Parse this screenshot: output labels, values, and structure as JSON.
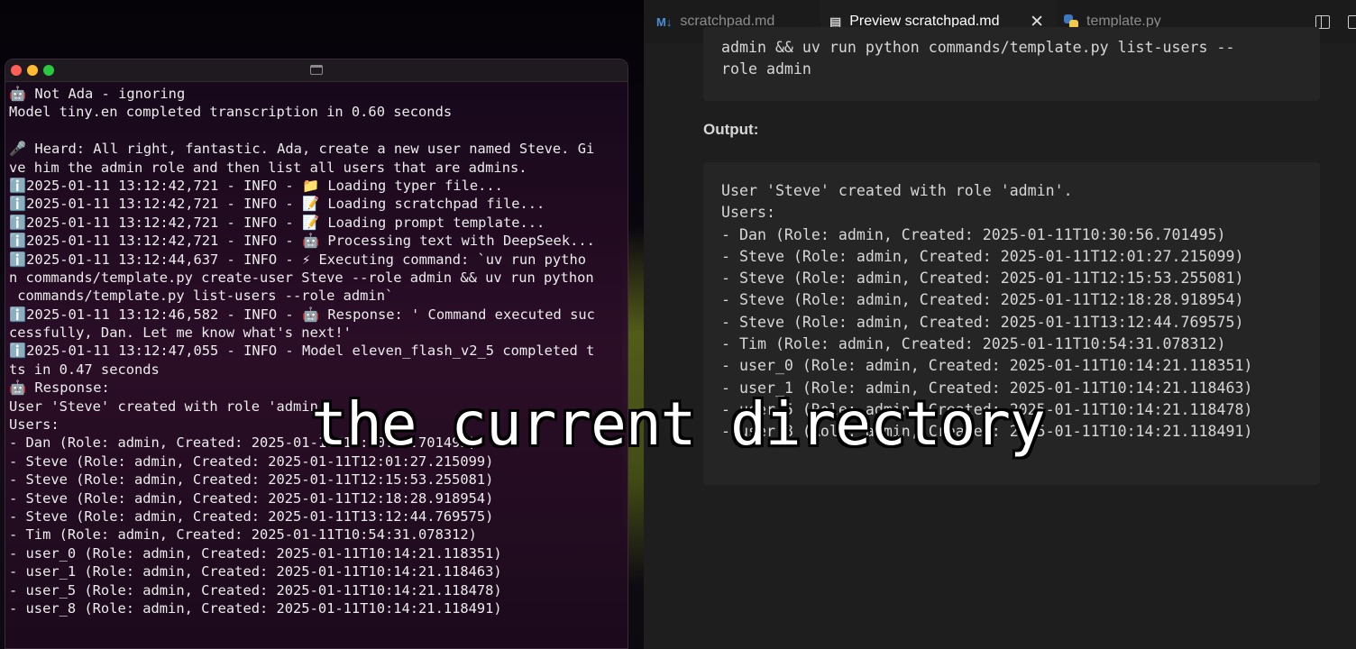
{
  "terminal": {
    "lines": [
      "🤖 Not Ada - ignoring",
      "Model tiny.en completed transcription in 0.60 seconds",
      "",
      "🎤 Heard: All right, fantastic. Ada, create a new user named Steve. Gi",
      "ve him the admin role and then list all users that are admins.",
      "ℹ️2025-01-11 13:12:42,721 - INFO - 📁 Loading typer file...",
      "ℹ️2025-01-11 13:12:42,721 - INFO - 📝 Loading scratchpad file...",
      "ℹ️2025-01-11 13:12:42,721 - INFO - 📝 Loading prompt template...",
      "ℹ️2025-01-11 13:12:42,721 - INFO - 🤖 Processing text with DeepSeek...",
      "ℹ️2025-01-11 13:12:44,637 - INFO - ⚡ Executing command: `uv run pytho",
      "n commands/template.py create-user Steve --role admin && uv run python",
      " commands/template.py list-users --role admin`",
      "ℹ️2025-01-11 13:12:46,582 - INFO - 🤖 Response: ' Command executed suc",
      "cessfully, Dan. Let me know what's next!'",
      "ℹ️2025-01-11 13:12:47,055 - INFO - Model eleven_flash_v2_5 completed t",
      "ts in 0.47 seconds",
      "🤖 Response:",
      "User 'Steve' created with role 'admin'.",
      "Users:",
      "- Dan (Role: admin, Created: 2025-01-11T10:30:56.701495)",
      "- Steve (Role: admin, Created: 2025-01-11T12:01:27.215099)",
      "- Steve (Role: admin, Created: 2025-01-11T12:15:53.255081)",
      "- Steve (Role: admin, Created: 2025-01-11T12:18:28.918954)",
      "- Steve (Role: admin, Created: 2025-01-11T13:12:44.769575)",
      "- Tim (Role: admin, Created: 2025-01-11T10:54:31.078312)",
      "- user_0 (Role: admin, Created: 2025-01-11T10:14:21.118351)",
      "- user_1 (Role: admin, Created: 2025-01-11T10:14:21.118463)",
      "- user_5 (Role: admin, Created: 2025-01-11T10:14:21.118478)",
      "- user_8 (Role: admin, Created: 2025-01-11T10:14:21.118491)"
    ]
  },
  "editor": {
    "tabs": [
      {
        "icon": "M↓",
        "label": "scratchpad.md",
        "active": false
      },
      {
        "icon": "▤",
        "label": "Preview scratchpad.md",
        "active": true
      },
      {
        "icon": "python-icon",
        "label": "template.py",
        "active": false
      }
    ],
    "close_glyph": "✕",
    "preview": {
      "command_lines": [
        "admin && uv run python commands/template.py list-users --",
        "role admin"
      ],
      "output_heading": "Output:",
      "output_lines": [
        "User 'Steve' created with role 'admin'.",
        "Users:",
        "- Dan (Role: admin, Created: 2025-01-11T10:30:56.701495)",
        "- Steve (Role: admin, Created: 2025-01-11T12:01:27.215099)",
        "- Steve (Role: admin, Created: 2025-01-11T12:15:53.255081)",
        "- Steve (Role: admin, Created: 2025-01-11T12:18:28.918954)",
        "- Steve (Role: admin, Created: 2025-01-11T13:12:44.769575)",
        "- Tim (Role: admin, Created: 2025-01-11T10:54:31.078312)",
        "- user_0 (Role: admin, Created: 2025-01-11T10:14:21.118351)",
        "- user_1 (Role: admin, Created: 2025-01-11T10:14:21.118463)",
        "- user_5 (Role: admin, Created: 2025-01-11T10:14:21.118478)",
        "- user_8 (Role: admin, Created: 2025-01-11T10:14:21.118491)"
      ]
    }
  },
  "caption": "the current directory",
  "colors": {
    "accent_tab_underline": "#d946b8",
    "markdown_icon": "#4a90d9",
    "python_blue": "#3b78c0",
    "python_yellow": "#f2c94c"
  }
}
